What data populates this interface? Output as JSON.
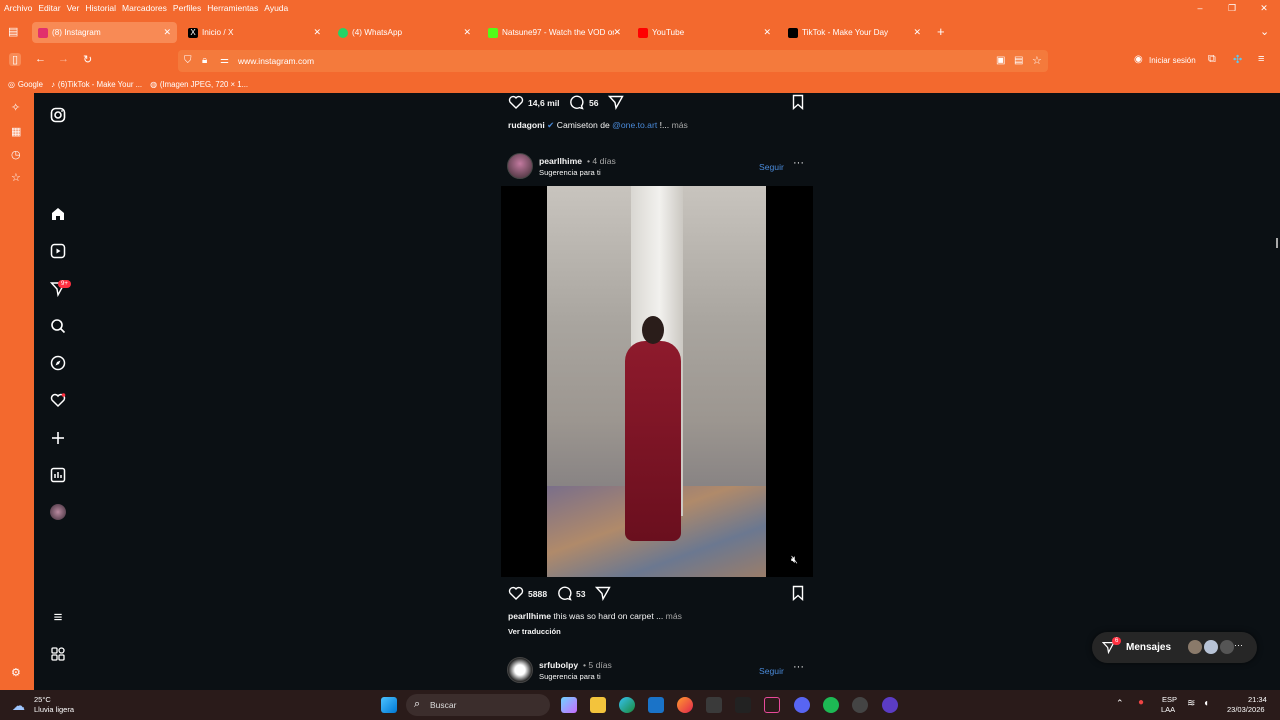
{
  "menu": [
    "Archivo",
    "Editar",
    "Ver",
    "Historial",
    "Marcadores",
    "Perfiles",
    "Herramientas",
    "Ayuda"
  ],
  "tabs": [
    {
      "label": "(8) Instagram",
      "color": "#e1306c",
      "active": true
    },
    {
      "label": "Inicio / X",
      "color": "#000000"
    },
    {
      "label": "(4) WhatsApp",
      "color": "#25d366"
    },
    {
      "label": "Natsune97 - Watch the VOD on",
      "color": "#53fc18"
    },
    {
      "label": "YouTube",
      "color": "#ff0000"
    },
    {
      "label": "TikTok - Make Your Day",
      "color": "#000000"
    }
  ],
  "url": "www.instagram.com",
  "signin_label": "Iniciar sesión",
  "bookmarks": [
    "Google",
    "(6)TikTok - Make Your ...",
    "(Imagen JPEG, 720 × 1..."
  ],
  "ig_sidebar": {
    "notification_badge": "9+"
  },
  "post1": {
    "likes": "14,6 mil",
    "comments": "56",
    "username": "rudagoni",
    "caption_text": "Camiseton de",
    "mention": "@one.to.art",
    "caption_tail": "!...",
    "more": "más"
  },
  "post2": {
    "username": "pearllhime",
    "time": "• 4 días",
    "suggestion": "Sugerencia para ti",
    "follow": "Seguir",
    "likes": "5888",
    "comments": "53",
    "caption": "this was so hard on carpet ...",
    "more": "más",
    "translate": "Ver traducción"
  },
  "post3": {
    "username": "srfubolpy",
    "time": "• 5 días",
    "suggestion": "Sugerencia para ti",
    "follow": "Seguir"
  },
  "messages": {
    "label": "Mensajes",
    "badge": "6"
  },
  "taskbar": {
    "weather_temp": "25°C",
    "weather_desc": "Lluvia ligera",
    "search_placeholder": "Buscar",
    "lang_top": "ESP",
    "lang_bottom": "LAA",
    "time": "21:34",
    "date": "23/03/2026"
  }
}
